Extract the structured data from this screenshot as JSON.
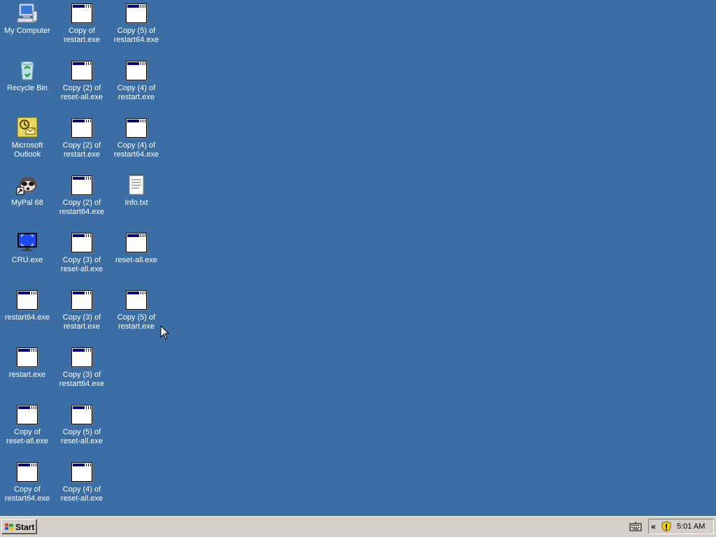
{
  "desktop": {
    "background_color": "#3a6ea5",
    "columns": [
      [
        {
          "label": "My Computer",
          "icon": "my-computer-icon"
        },
        {
          "label": "Recycle Bin",
          "icon": "recycle-bin-icon"
        },
        {
          "label": "Microsoft\nOutlook",
          "icon": "outlook-icon"
        },
        {
          "label": "MyPal 68",
          "icon": "mypal-icon"
        },
        {
          "label": "CRU.exe",
          "icon": "monitor-icon"
        },
        {
          "label": "restart64.exe",
          "icon": "app-window-icon"
        },
        {
          "label": "restart.exe",
          "icon": "app-window-icon"
        },
        {
          "label": "Copy of\nreset-all.exe",
          "icon": "app-window-icon"
        },
        {
          "label": "Copy of\nrestart64.exe",
          "icon": "app-window-icon"
        }
      ],
      [
        {
          "label": "Copy of\nrestart.exe",
          "icon": "app-window-icon"
        },
        {
          "label": "Copy (2) of\nreset-all.exe",
          "icon": "app-window-icon"
        },
        {
          "label": "Copy (2) of\nrestart.exe",
          "icon": "app-window-icon"
        },
        {
          "label": "Copy (2) of\nrestart64.exe",
          "icon": "app-window-icon"
        },
        {
          "label": "Copy (3) of\nreset-all.exe",
          "icon": "app-window-icon"
        },
        {
          "label": "Copy (3) of\nrestart.exe",
          "icon": "app-window-icon"
        },
        {
          "label": "Copy (3) of\nrestart64.exe",
          "icon": "app-window-icon"
        },
        {
          "label": "Copy (5) of\nreset-all.exe",
          "icon": "app-window-icon"
        },
        {
          "label": "Copy (4) of\nreset-all.exe",
          "icon": "app-window-icon"
        }
      ],
      [
        {
          "label": "Copy (5) of\nrestart64.exe",
          "icon": "app-window-icon"
        },
        {
          "label": "Copy (4) of\nrestart.exe",
          "icon": "app-window-icon"
        },
        {
          "label": "Copy (4) of\nrestart64.exe",
          "icon": "app-window-icon"
        },
        {
          "label": "Info.txt",
          "icon": "text-file-icon"
        },
        {
          "label": "reset-all.exe",
          "icon": "app-window-icon"
        },
        {
          "label": "Copy (5) of\nrestart.exe",
          "icon": "app-window-icon"
        }
      ]
    ]
  },
  "taskbar": {
    "start_label": "Start",
    "tray_expand_label": "«",
    "clock": "5:01 AM",
    "icons": [
      "keyboard-icon",
      "shield-icon"
    ]
  }
}
